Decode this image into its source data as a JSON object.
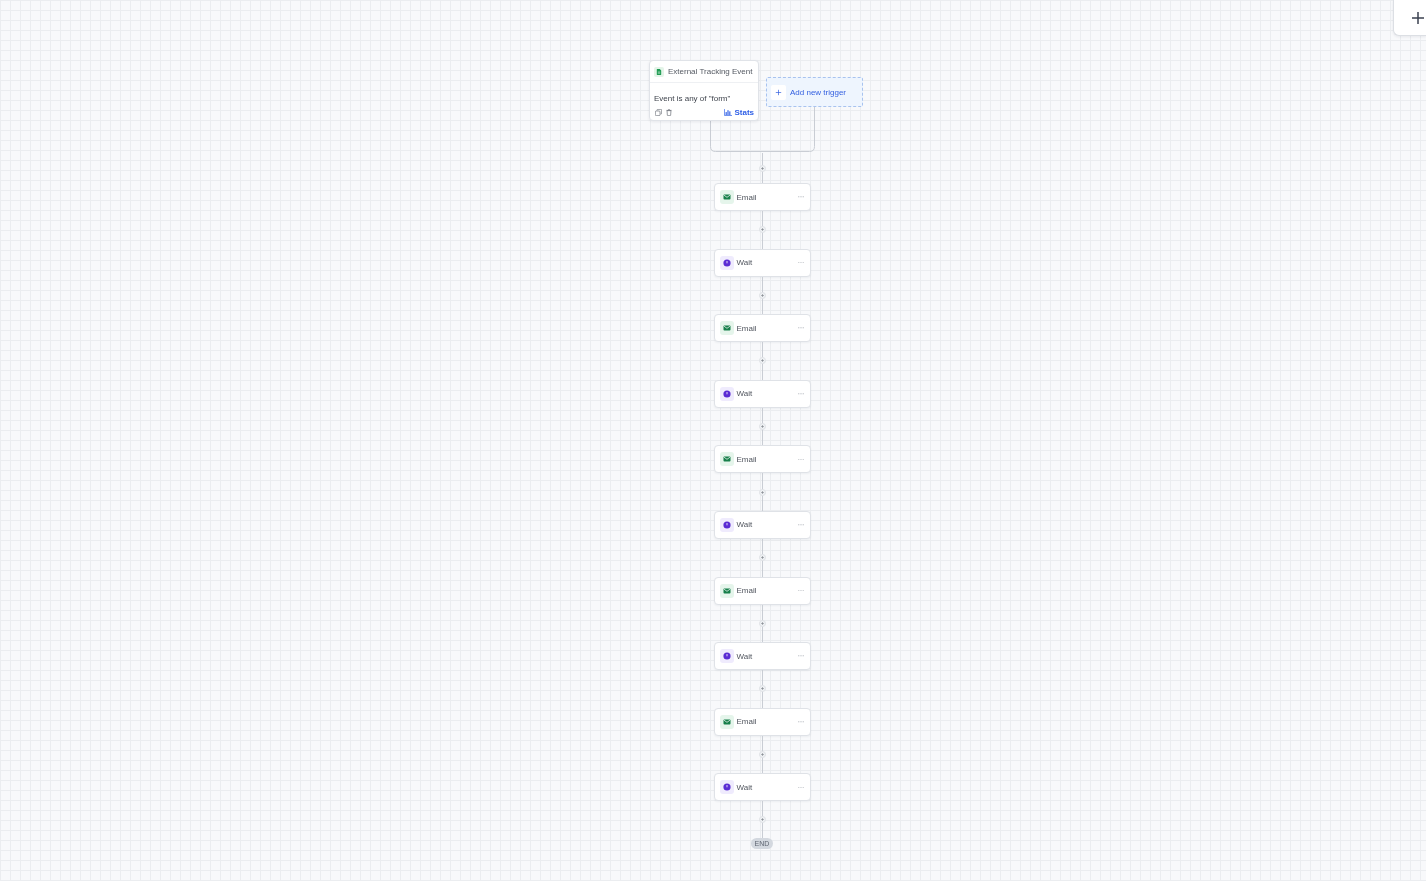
{
  "trigger": {
    "title": "External Tracking Event",
    "condition": "Event is any of \"form\"",
    "stats_label": "Stats"
  },
  "add_trigger": {
    "label": "Add new trigger"
  },
  "steps": [
    {
      "kind": "email",
      "label": "Email"
    },
    {
      "kind": "wait",
      "label": "Wait"
    },
    {
      "kind": "email",
      "label": "Email"
    },
    {
      "kind": "wait",
      "label": "Wait"
    },
    {
      "kind": "email",
      "label": "Email"
    },
    {
      "kind": "wait",
      "label": "Wait"
    },
    {
      "kind": "email",
      "label": "Email"
    },
    {
      "kind": "wait",
      "label": "Wait"
    },
    {
      "kind": "email",
      "label": "Email"
    },
    {
      "kind": "wait",
      "label": "Wait"
    }
  ],
  "end": {
    "label": "END"
  }
}
